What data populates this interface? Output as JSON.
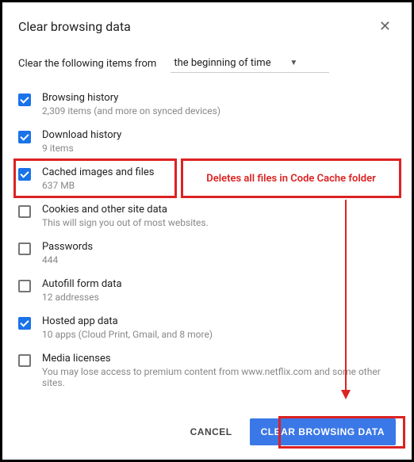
{
  "header": {
    "title": "Clear browsing data"
  },
  "time": {
    "label": "Clear the following items from",
    "value": "the beginning of time"
  },
  "items": [
    {
      "title": "Browsing history",
      "sub": "2,309 items (and more on synced devices)",
      "checked": true
    },
    {
      "title": "Download history",
      "sub": "9 items",
      "checked": true
    },
    {
      "title": "Cached images and files",
      "sub": "637 MB",
      "checked": true
    },
    {
      "title": "Cookies and other site data",
      "sub": "This will sign you out of most websites.",
      "checked": false
    },
    {
      "title": "Passwords",
      "sub": "444",
      "checked": false
    },
    {
      "title": "Autofill form data",
      "sub": "12 addresses",
      "checked": false
    },
    {
      "title": "Hosted app data",
      "sub": "10 apps (Cloud Print, Gmail, and 8 more)",
      "checked": true
    },
    {
      "title": "Media licenses",
      "sub": "You may lose access to premium content from www.netflix.com and some other sites.",
      "checked": false
    }
  ],
  "buttons": {
    "cancel": "CANCEL",
    "primary": "CLEAR BROWSING DATA"
  },
  "annotation": {
    "text": "Deletes all files in Code Cache folder"
  }
}
